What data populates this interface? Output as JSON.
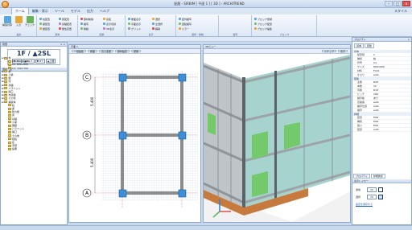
{
  "window": {
    "title": "配筋 - SIRBIM [ 平面 1 ] [ 3D ] - ARCHITREND"
  },
  "tabs": [
    {
      "label": "ホーム",
      "active": true
    },
    {
      "label": "編集・表示"
    },
    {
      "label": "ツール"
    },
    {
      "label": "モデル"
    },
    {
      "label": "出力"
    },
    {
      "label": "ヘルプ"
    }
  ],
  "help_label": "スタイル",
  "ribbon": {
    "groups": [
      {
        "label": "設計"
      },
      {
        "label": "部材"
      },
      {
        "label": "配筋"
      },
      {
        "label": "表示"
      },
      {
        "label": "選択・移動"
      },
      {
        "label": "複写"
      },
      {
        "label": "ブロック"
      }
    ],
    "big_buttons": [
      {
        "label": "構造計算",
        "color": "#5aa6e0"
      },
      {
        "label": "入力",
        "color": "#e7a83a"
      },
      {
        "label": "チェック",
        "color": "#6bb35a"
      }
    ],
    "small_items": [
      "柱配置",
      "梁配置",
      "壁配置",
      "床配置",
      "基礎配置",
      "属性変更",
      "部材削除",
      "複写",
      "移動",
      "反転",
      "表示切替",
      "3D表示",
      "断面表示",
      "平面表示",
      "グリッド",
      "選択",
      "全選択",
      "解除",
      "配列複写",
      "回転複写",
      "ミラー",
      "ブロック登録",
      "ブロック配置",
      "ブロック編集"
    ]
  },
  "left_panel": {
    "title": "階層",
    "floor": "1F / ▲2SL",
    "floor_nav": [
      "▼1F↓",
      "▲2SL↑",
      "▼1F↑",
      "▲上層"
    ],
    "tree_title": "部材一覧",
    "tree": [
      "柱",
      "C1: 600×600",
      "C2: 600×600",
      "C3: 700×700",
      "梁",
      "小梁",
      "壁",
      "床",
      "基礎",
      "パラペット",
      "開口",
      "布基礎",
      "その他",
      "構造体",
      "柱",
      "梁",
      "耐力壁",
      "床",
      "基礎",
      "小梁",
      "雑壁",
      "パラペット",
      "開口",
      "その他",
      "階段",
      "庇",
      "手摺",
      "設備"
    ]
  },
  "plan_view": {
    "title": "平面 1",
    "tools": [
      "一括編集",
      "断面",
      "高さ変更",
      "部材設定",
      "配筋"
    ],
    "axes": {
      "rows": [
        "C",
        "B",
        "A"
      ]
    },
    "dims": [
      "5,400",
      "5,400"
    ]
  },
  "view3d": {
    "title": "3Dビュー",
    "tools": [
      "スナップ",
      "表示"
    ]
  },
  "properties": {
    "title": "プロパティ",
    "tabs": [
      "基本",
      "配筋"
    ],
    "sections": [
      {
        "header": "基本",
        "rows": [
          {
            "k": "配置階",
            "v": "1"
          },
          {
            "k": "種別",
            "v": "柱"
          },
          {
            "k": "符号",
            "v": "C1"
          },
          {
            "k": "サイズ",
            "v": "600×600"
          },
          {
            "k": "材料",
            "v": "Fc24"
          },
          {
            "k": "かぶり",
            "v": "auto"
          }
        ]
      },
      {
        "header": "配筋",
        "rows": [
          {
            "k": "主筋",
            "v": "D25"
          },
          {
            "k": "本数",
            "v": "12"
          },
          {
            "k": "帯筋",
            "v": "D13"
          },
          {
            "k": "ピッチ",
            "v": "100"
          },
          {
            "k": "副帯筋",
            "v": "あり"
          },
          {
            "k": "定着長",
            "v": "auto"
          },
          {
            "k": "継手位置",
            "v": "auto"
          },
          {
            "k": "継手",
            "v": "auto"
          }
        ]
      },
      {
        "header": "詳細",
        "rows": [
          {
            "k": "配置",
            "v": "M12"
          },
          {
            "k": "種別",
            "v": "M12"
          },
          {
            "k": "長さ",
            "v": "M12"
          },
          {
            "k": "配置",
            "v": "auto"
          }
        ]
      }
    ],
    "bottom_tabs": [
      "プロパティ",
      "詳細確認"
    ],
    "tools_header": "表示レイヤー",
    "tools": [
      {
        "label": "通常",
        "value": "70"
      },
      {
        "label": "選択",
        "value": "70"
      }
    ],
    "footer_link": "設定を保存する"
  }
}
